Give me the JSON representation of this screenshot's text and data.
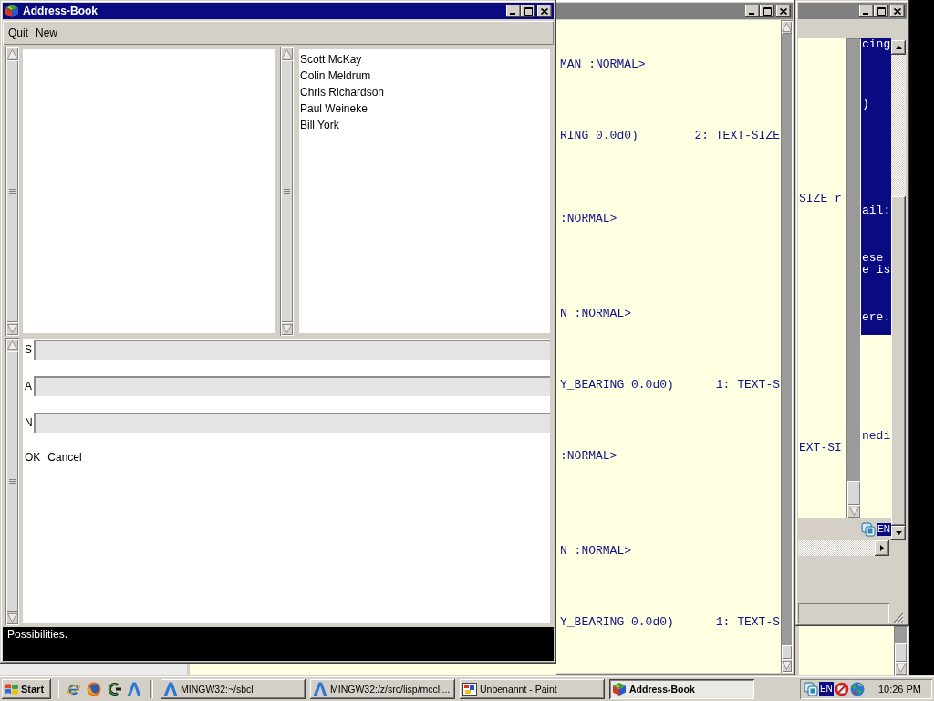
{
  "address_book": {
    "title": "Address-Book",
    "active": true,
    "menu": [
      "Quit",
      "New"
    ],
    "names": [
      "Scott McKay",
      "Colin Meldrum",
      "Chris Richardson",
      "Paul Weineke",
      "Bill York"
    ],
    "form": {
      "fields": [
        {
          "label": "S"
        },
        {
          "label": "A"
        },
        {
          "label": "N"
        }
      ],
      "buttons": [
        "OK",
        "Cancel"
      ]
    },
    "status": "Possibilities."
  },
  "listener_window": {
    "active": false,
    "lines": [
      {
        "text": "MAN :NORMAL>"
      },
      {
        "text": "RING 0.0d0)",
        "text_2": "2: TEXT-SIZE"
      },
      {
        "text": ":NORMAL>"
      },
      {
        "text": "N :NORMAL>"
      },
      {
        "text": "Y_BEARING 0.0d0)",
        "text_2": "1: TEXT-S"
      },
      {
        "text": ":NORMAL>"
      },
      {
        "text": "N :NORMAL>"
      },
      {
        "text": "Y_BEARING 0.0d0)",
        "text_2": "1: TEXT-S"
      }
    ]
  },
  "right_window": {
    "active": false,
    "left_pane": [
      "SIZE r",
      "EXT-SI"
    ],
    "text_pane": [
      {
        "text": "cing",
        "selected": true
      },
      {
        "text": ")",
        "selected": true
      },
      {
        "text": "ail:",
        "selected": true
      },
      {
        "text": "ese",
        "selected": true
      },
      {
        "text": "e is",
        "selected": true
      },
      {
        "text": "ere.",
        "selected": true
      },
      {
        "text": "nedi",
        "selected": false
      }
    ],
    "language": "EN"
  },
  "taskbar": {
    "start": "Start",
    "tasks": [
      {
        "label": "MINGW32:~/sbcl",
        "kind": "terminal",
        "selected": false
      },
      {
        "label": "MINGW32:/z/src/lisp/mccli...",
        "kind": "terminal",
        "selected": false
      },
      {
        "label": "Unbenannt - Paint",
        "kind": "paint",
        "selected": false
      },
      {
        "label": "Address-Book",
        "kind": "app",
        "selected": true
      }
    ],
    "language": "EN",
    "clock": "10:26 PM"
  }
}
